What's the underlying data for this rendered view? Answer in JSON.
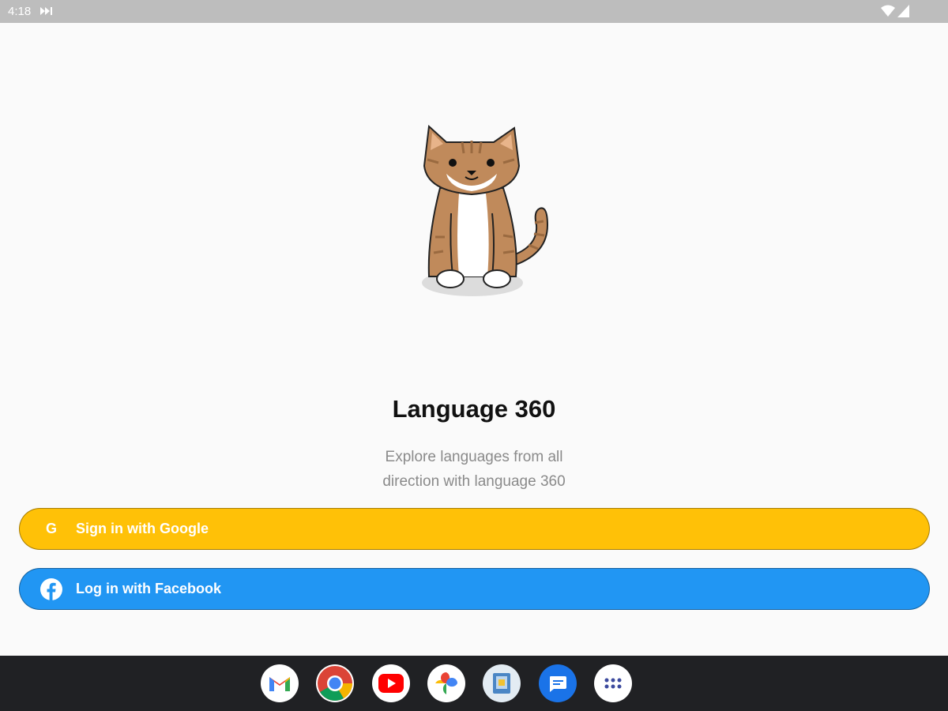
{
  "status_bar": {
    "time": "4:18"
  },
  "app": {
    "title": "Language 360",
    "subtitle": "Explore languages from all direction with language 360"
  },
  "buttons": {
    "google": {
      "label": "Sign in with Google",
      "icon": "google-g-icon",
      "color": "#ffc107"
    },
    "facebook": {
      "label": "Log in with Facebook",
      "icon": "facebook-icon",
      "color": "#2196f3"
    }
  },
  "taskbar": {
    "apps": [
      "gmail",
      "chrome",
      "youtube",
      "photos",
      "files",
      "messages",
      "app-launcher"
    ]
  }
}
